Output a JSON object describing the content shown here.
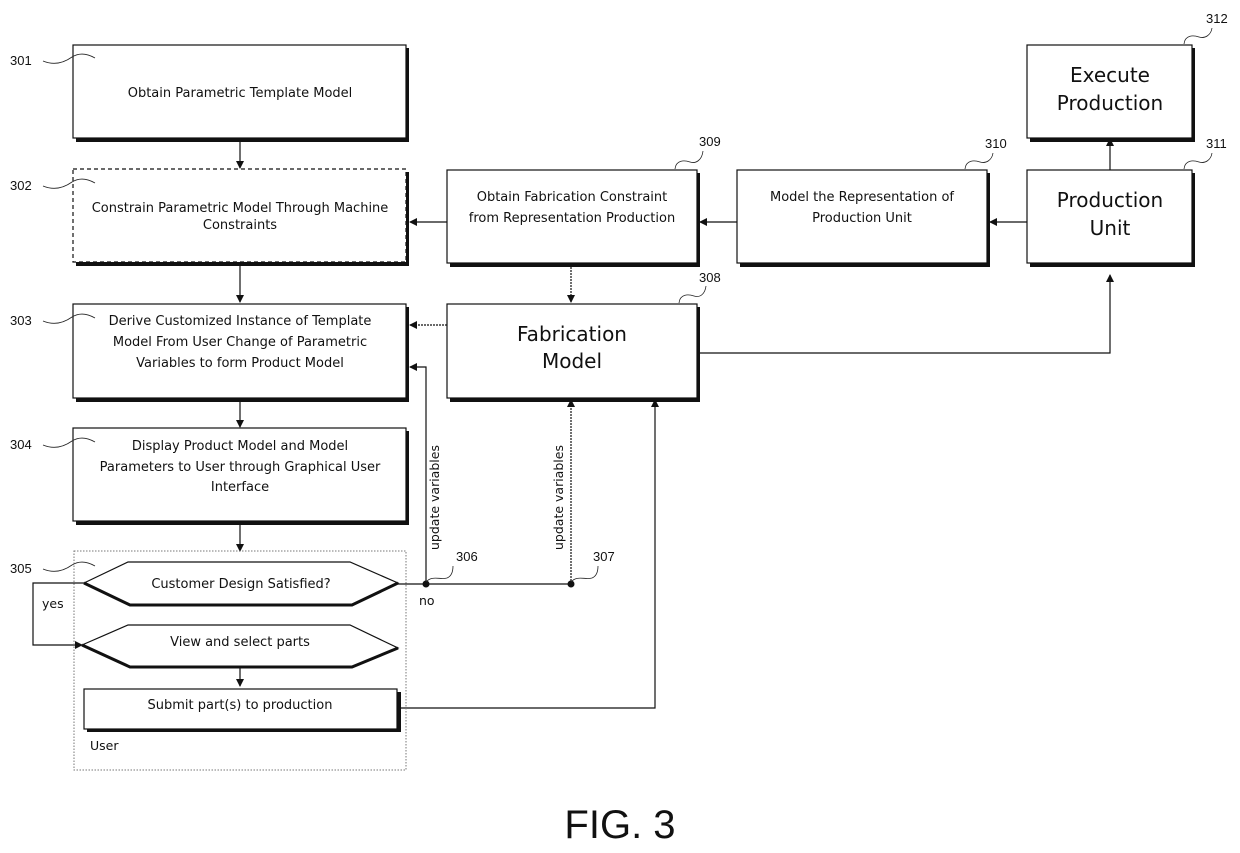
{
  "figure": {
    "caption": "FIG. 3"
  },
  "nodes": {
    "n301": {
      "ref": "301",
      "lines": [
        "Obtain Parametric Template Model"
      ]
    },
    "n302": {
      "ref": "302",
      "lines": [
        "Constrain Parametric Model Through Machine",
        "Constraints"
      ]
    },
    "n303": {
      "ref": "303",
      "lines": [
        "Derive Customized Instance of Template",
        "Model From User Change of Parametric",
        "Variables to form Product Model"
      ]
    },
    "n304": {
      "ref": "304",
      "lines": [
        "Display Product Model and  Model",
        "Parameters to User through Graphical User",
        "Interface"
      ]
    },
    "n305": {
      "ref": "305",
      "lines": [
        "Customer Design Satisfied?"
      ]
    },
    "view_select": {
      "lines": [
        "View and select parts"
      ]
    },
    "submit": {
      "lines": [
        "Submit part(s) to production"
      ]
    },
    "user_group": {
      "label": "User"
    },
    "n306": {
      "ref": "306"
    },
    "n307": {
      "ref": "307"
    },
    "n308": {
      "ref": "308",
      "lines": [
        "Fabrication",
        "Model"
      ]
    },
    "n309": {
      "ref": "309",
      "lines": [
        "Obtain Fabrication Constraint",
        "from Representation Production"
      ]
    },
    "n310": {
      "ref": "310",
      "lines": [
        "Model the Representation of",
        "Production Unit"
      ]
    },
    "n311": {
      "ref": "311",
      "lines": [
        "Production",
        "Unit"
      ]
    },
    "n312": {
      "ref": "312",
      "lines": [
        "Execute",
        "Production"
      ]
    }
  },
  "edge_labels": {
    "yes": "yes",
    "no": "no",
    "update_variables_1": "update variables",
    "update_variables_2": "update variables"
  }
}
